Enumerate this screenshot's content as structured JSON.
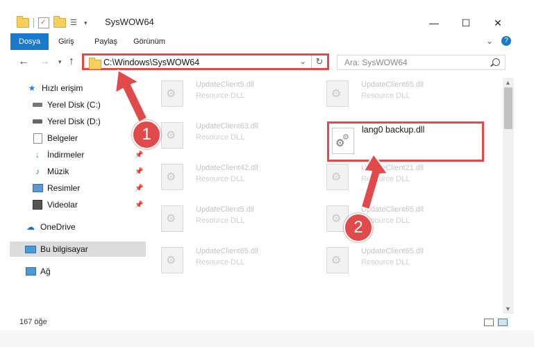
{
  "window": {
    "title": "SysWOW64",
    "controls": {
      "minimize": "—",
      "maximize": "☐",
      "close": "✕"
    }
  },
  "ribbon": {
    "tabs": [
      "Dosya",
      "Giriş",
      "Paylaş",
      "Görünüm"
    ],
    "collapse": "⌄",
    "help": "?"
  },
  "address": {
    "path": "C:\\Windows\\SysWOW64",
    "search_placeholder": "Ara: SysWOW64"
  },
  "nav": {
    "items": [
      {
        "label": "Hızlı erişim",
        "icon": "star-icon"
      },
      {
        "label": "Yerel Disk (C:)",
        "icon": "drive-icon"
      },
      {
        "label": "Yerel Disk (D:)",
        "icon": "drive-icon"
      },
      {
        "label": "Belgeler",
        "icon": "documents-icon"
      },
      {
        "label": "İndirmeler",
        "icon": "download-icon"
      },
      {
        "label": "Müzik",
        "icon": "music-icon"
      },
      {
        "label": "Resimler",
        "icon": "pictures-icon"
      },
      {
        "label": "Videolar",
        "icon": "videos-icon"
      },
      {
        "label": "OneDrive",
        "icon": "cloud-icon"
      },
      {
        "label": "Bu bilgisayar",
        "icon": "computer-icon"
      },
      {
        "label": "Ağ",
        "icon": "network-icon"
      }
    ]
  },
  "files": [
    {
      "name": "UpdateClient5.dll",
      "type": "Resource DLL"
    },
    {
      "name": "UpdateClient65.dll",
      "type": "Resource DLL"
    },
    {
      "name": "UpdateClient63.dll",
      "type": "Resource DLL"
    },
    {
      "name": "UpdateClient42.dll",
      "type": "Resource DLL"
    },
    {
      "name": "UpdateClient21.dll",
      "type": "Resource DLL"
    },
    {
      "name": "UpdateClient5.dll",
      "type": "Resource DLL"
    },
    {
      "name": "UpdateClient65.dll",
      "type": "Resource DLL"
    },
    {
      "name": "UpdateClient65.dll",
      "type": "Resource DLL"
    },
    {
      "name": "UpdateClient65.dll",
      "type": "Resource DLL"
    }
  ],
  "highlighted_file": {
    "name": "lang0 backup.dll"
  },
  "annotations": {
    "step1": "1",
    "step2": "2"
  },
  "status": {
    "count": "167 öğe"
  },
  "colors": {
    "accent": "#1979ca",
    "annotation": "#e14a4a"
  }
}
